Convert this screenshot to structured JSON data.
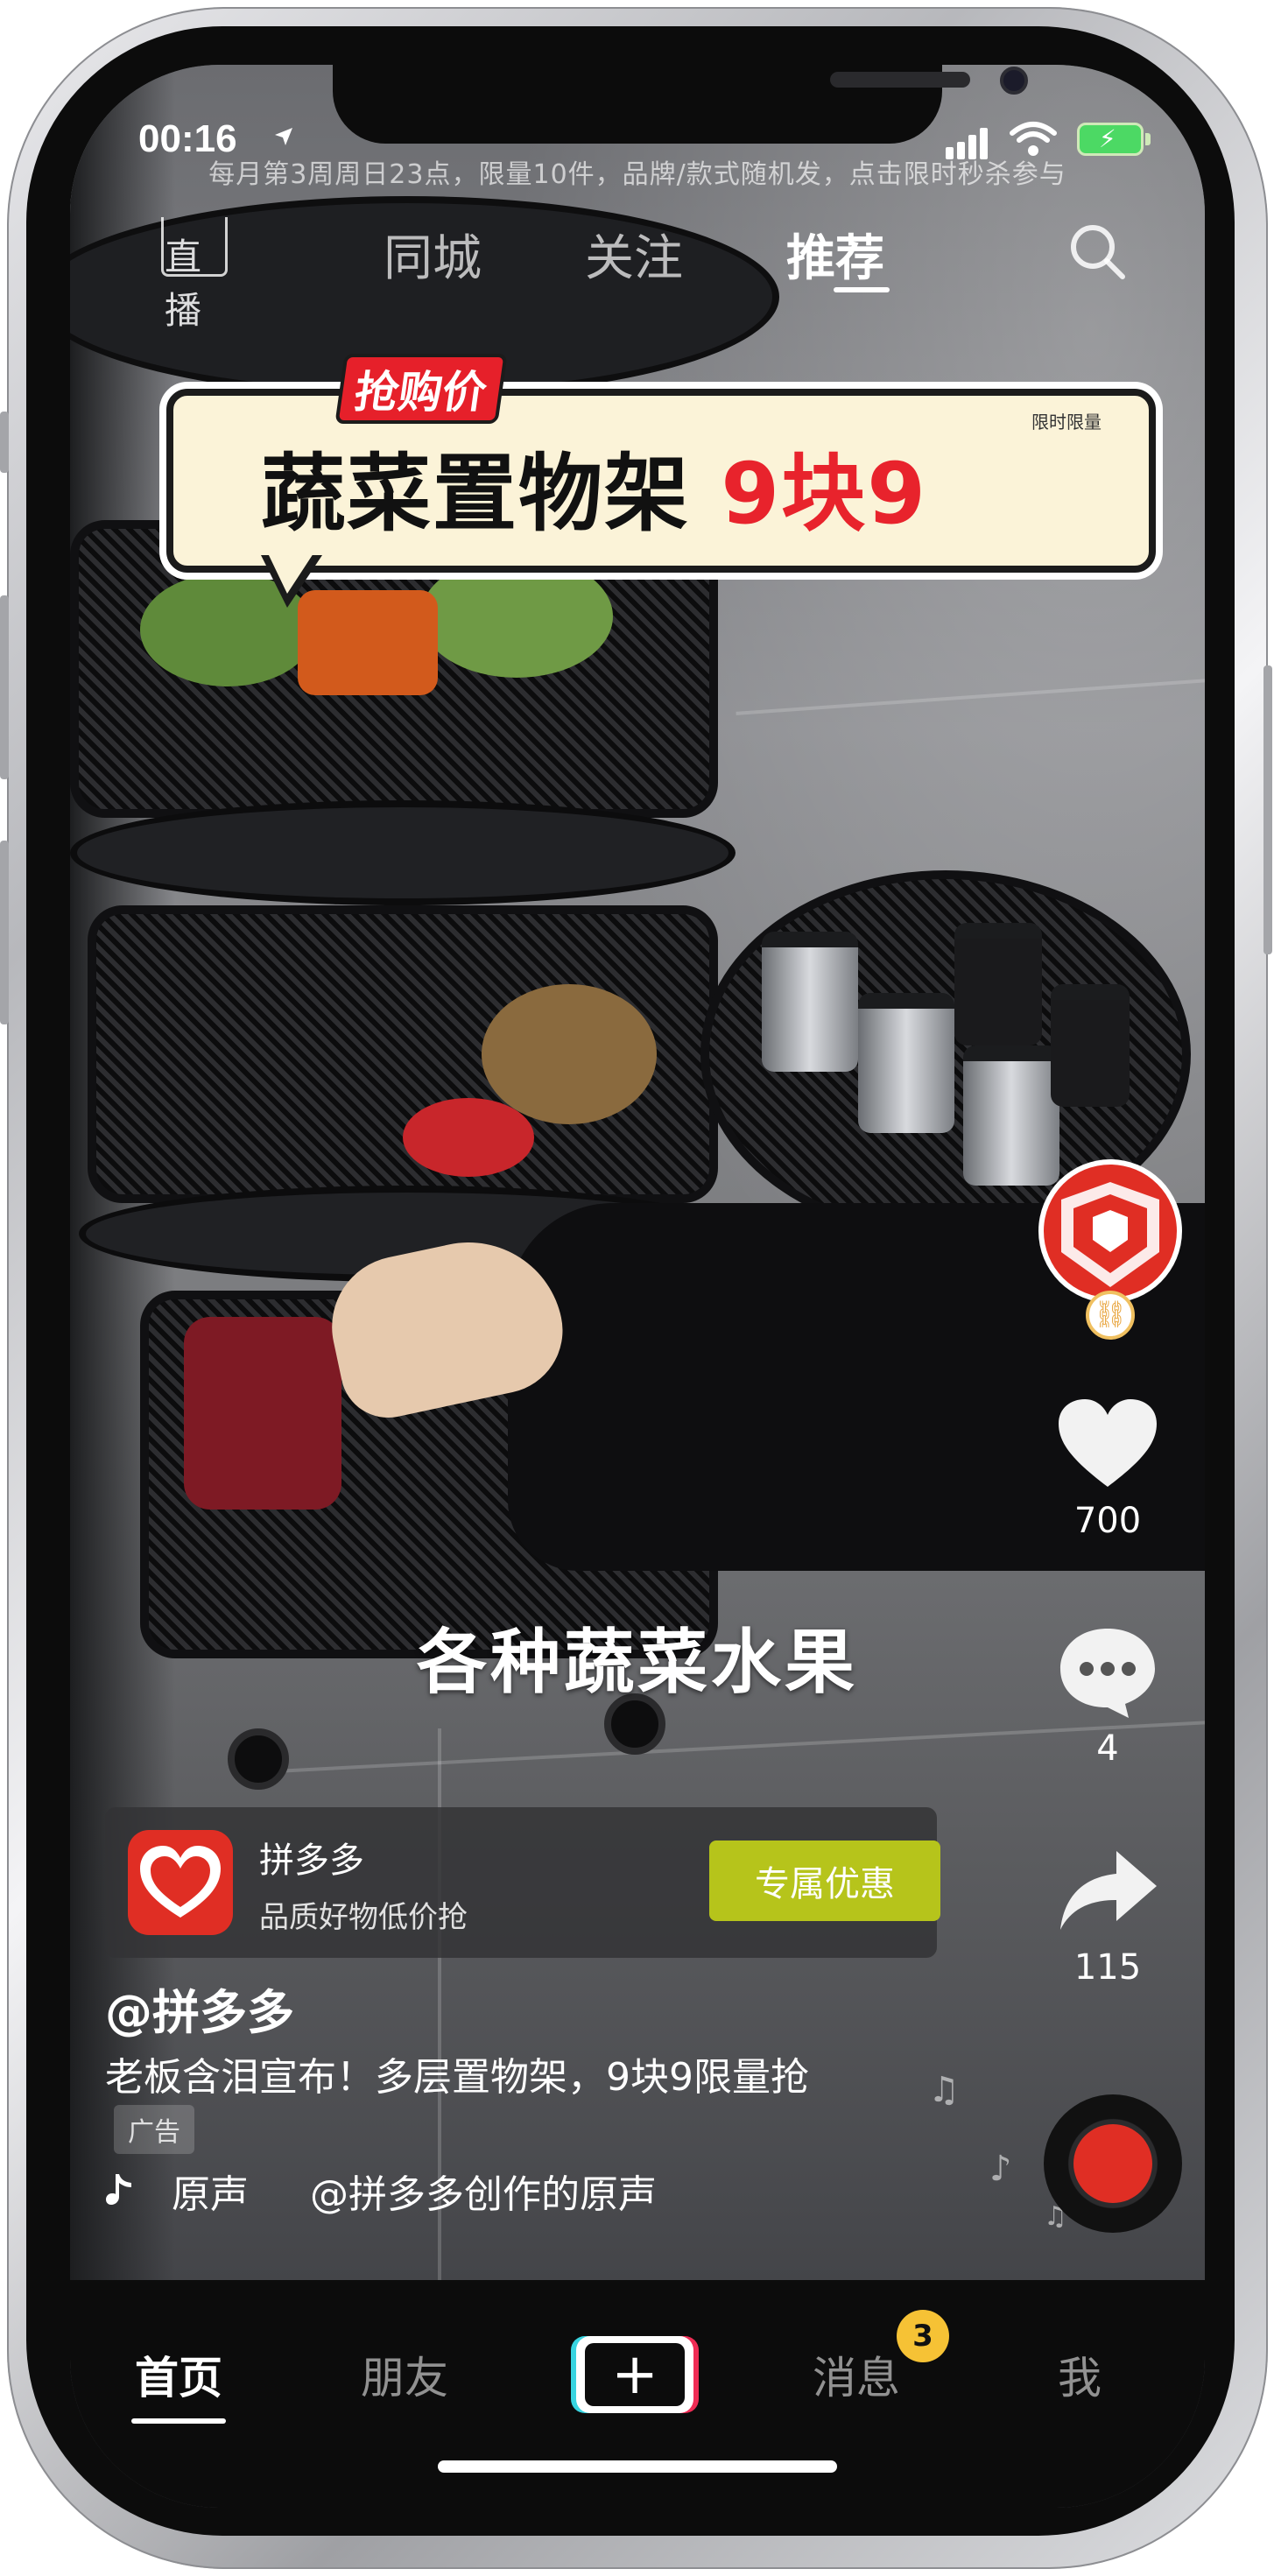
{
  "status_bar": {
    "time": "00:16"
  },
  "ticker_text": "每月第3周周日23点，限量10件，品牌/款式随机发，点击限时秒杀参与",
  "top_nav": {
    "live_label": "直播",
    "tabs": [
      {
        "label": "同城",
        "active": false
      },
      {
        "label": "关注",
        "active": false
      },
      {
        "label": "推荐",
        "active": true
      }
    ]
  },
  "promo": {
    "price_tag": "抢购价",
    "title": "蔬菜置物架 ",
    "price": "9块9",
    "limit_note": "限时限量"
  },
  "video_subtitle": "各种蔬菜水果",
  "right_rail": {
    "avatar_name": "pinduoduo-avatar",
    "likes": "700",
    "comments": "4",
    "shares": "115"
  },
  "ad_card": {
    "name": "拼多多",
    "description": "品质好物低价抢",
    "button_label": "专属优惠"
  },
  "post": {
    "author": "@拼多多",
    "caption": "老板含泪宣布！多层置物架，9块9限量抢",
    "ad_tag": "广告",
    "music_label": "原声",
    "music_credit": "@拼多多创作的原声"
  },
  "bottom_nav": {
    "items": [
      {
        "label": "首页",
        "active": true
      },
      {
        "label": "朋友",
        "active": false
      },
      {
        "label": "消息",
        "active": false,
        "badge": "3"
      },
      {
        "label": "我",
        "active": false
      }
    ]
  },
  "colors": {
    "brand_red": "#e02e24",
    "ad_button": "#b6c41b",
    "badge_yellow": "#f6c235",
    "promo_price": "#e8232c"
  }
}
